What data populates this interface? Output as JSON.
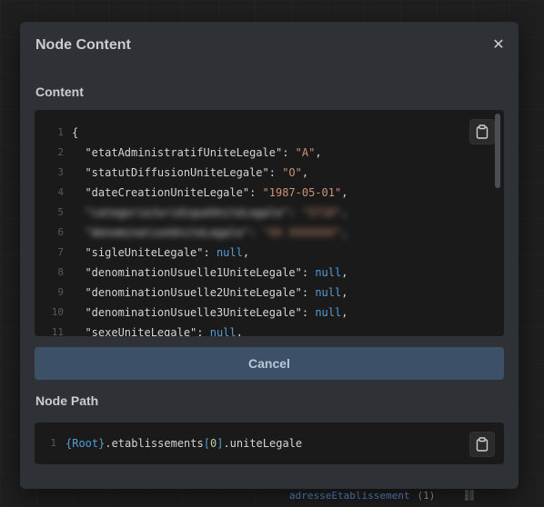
{
  "modal": {
    "title": "Node Content",
    "close_label": "✕",
    "cancel_label": "Cancel"
  },
  "content": {
    "label": "Content",
    "lines": [
      {
        "n": "1",
        "open": "{"
      },
      {
        "n": "2",
        "key": "\"etatAdministratifUniteLegale\"",
        "sep": ": ",
        "str": "\"A\"",
        "comma": ","
      },
      {
        "n": "3",
        "key": "\"statutDiffusionUniteLegale\"",
        "sep": ": ",
        "str": "\"O\"",
        "comma": ","
      },
      {
        "n": "4",
        "key": "\"dateCreationUniteLegale\"",
        "sep": ": ",
        "str": "\"1987-05-01\"",
        "comma": ","
      },
      {
        "n": "5",
        "key": "\"categorieJuridiqueUniteLegale\"",
        "sep": ": ",
        "str": "\"5710\"",
        "comma": ",",
        "blurred": true
      },
      {
        "n": "6",
        "key": "\"denominationUniteLegale\"",
        "sep": ": ",
        "str": "\"XX XXXXXXX\"",
        "comma": ",",
        "blurred": true
      },
      {
        "n": "7",
        "key": "\"sigleUniteLegale\"",
        "sep": ": ",
        "nul": "null",
        "comma": ","
      },
      {
        "n": "8",
        "key": "\"denominationUsuelle1UniteLegale\"",
        "sep": ": ",
        "nul": "null",
        "comma": ","
      },
      {
        "n": "9",
        "key": "\"denominationUsuelle2UniteLegale\"",
        "sep": ": ",
        "nul": "null",
        "comma": ","
      },
      {
        "n": "10",
        "key": "\"denominationUsuelle3UniteLegale\"",
        "sep": ": ",
        "nul": "null",
        "comma": ","
      },
      {
        "n": "11",
        "key": "\"sexeUniteLegale\"",
        "sep": ": ",
        "nul": "null",
        "comma": ","
      }
    ]
  },
  "path": {
    "label": "Node Path",
    "line_number": "1",
    "root": "{Root}",
    "seg1": ".etablissements",
    "open_bracket": "[",
    "index": "0",
    "close_bracket": "]",
    "seg2": ".uniteLegale"
  },
  "background": {
    "node_label": "adresseEtablissement",
    "node_count": "(1)"
  }
}
